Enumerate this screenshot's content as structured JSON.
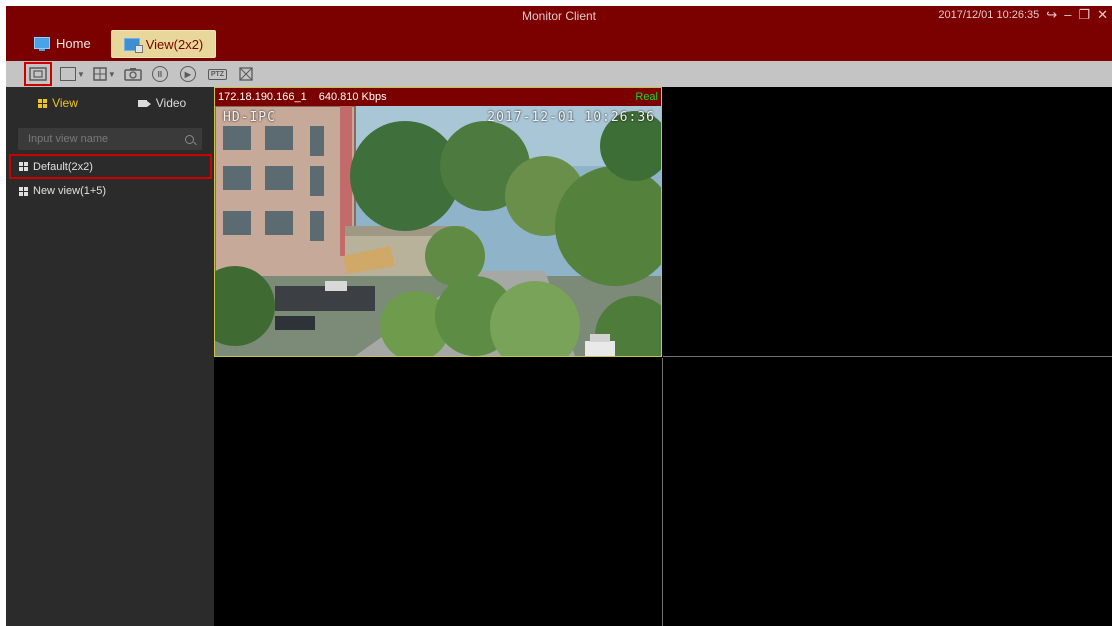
{
  "window": {
    "title": "Monitor Client",
    "datetime": "2017/12/01 10:26:35"
  },
  "tabs": [
    {
      "label": "Home",
      "active": false,
      "icon": "monitor-icon"
    },
    {
      "label": "View(2x2)",
      "active": true,
      "icon": "view-grid-icon"
    }
  ],
  "toolbar": {
    "items": [
      "video-wall-icon",
      "window-layout-icon",
      "screen-split-icon",
      "snapshot-icon",
      "pause-icon",
      "play-icon",
      "ptz-icon",
      "fullscreen-icon"
    ],
    "ptz_label": "PTZ"
  },
  "sidebar": {
    "tabs": [
      {
        "label": "View",
        "active": true
      },
      {
        "label": "Video",
        "active": false
      }
    ],
    "search_placeholder": "Input view name",
    "views": [
      {
        "label": "Default(2x2)",
        "selected": true
      },
      {
        "label": "New view(1+5)",
        "selected": false
      }
    ]
  },
  "player": {
    "stream": "172.18.190.166_1",
    "bitrate": "640.810 Kbps",
    "mode": "Real",
    "osd_left": "HD-IPC",
    "osd_right": "2017-12-01 10:26:36"
  },
  "colors": {
    "titlebar": "#7b0000",
    "active_tab": "#e8d79a",
    "sidebar_bg": "#2b2b2b",
    "selection_border": "#cc0000",
    "real_indicator": "#19d82a"
  }
}
